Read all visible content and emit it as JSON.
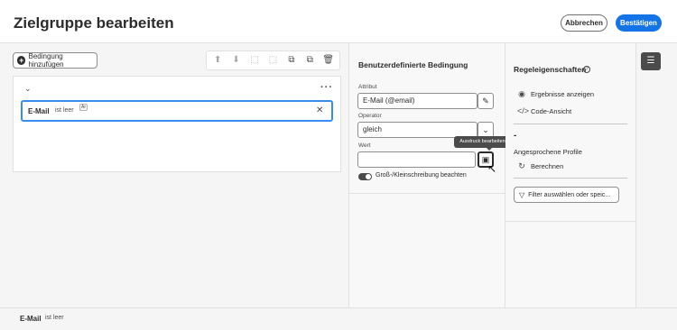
{
  "header": {
    "title": "Zielgruppe bearbeiten",
    "cancel_label": "Abbrechen",
    "confirm_label": "Bestätigen"
  },
  "canvas": {
    "add_condition_label": "Bedingung hinzufügen",
    "toolbar_icons": [
      "arrow-up-icon",
      "arrow-down-icon",
      "group-icon",
      "ungroup-icon",
      "copy-icon",
      "duplicate-icon",
      "delete-icon"
    ],
    "condition": {
      "attribute": "E-Mail",
      "operator": "ist leer",
      "badge": "Ar"
    }
  },
  "status_bar": {
    "attribute": "E-Mail",
    "operator": "ist leer"
  },
  "custom_condition": {
    "heading": "Benutzerdefinierte Bedingung",
    "attribute_label": "Attribut",
    "attribute_value": "E-Mail (@email)",
    "operator_label": "Operator",
    "operator_value": "gleich",
    "value_label": "Wert",
    "value_value": "",
    "case_sensitive_label": "Groß-/Kleinschreibung beachten",
    "case_sensitive_on": true,
    "tooltip": "Ausdruck bearbeiten"
  },
  "rule_properties": {
    "heading": "Regeleigenschaften",
    "show_results_label": "Ergebnisse anzeigen",
    "code_view_label": "Code-Ansicht",
    "profiles_count": "-",
    "targeted_profiles_label": "Angesprochene Profile",
    "calculate_label": "Berechnen",
    "filter_placeholder": "Filter auswählen oder speic..."
  }
}
